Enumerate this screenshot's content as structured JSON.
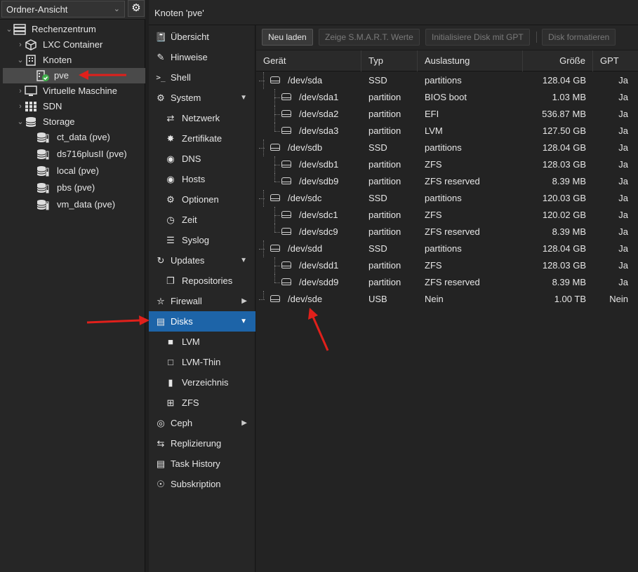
{
  "tree": {
    "view_select": "Ordner-Ansicht",
    "items": [
      {
        "label": "Rechenzentrum"
      },
      {
        "label": "LXC Container"
      },
      {
        "label": "Knoten"
      },
      {
        "label": "pve"
      },
      {
        "label": "Virtuelle Maschine"
      },
      {
        "label": "SDN"
      },
      {
        "label": "Storage"
      },
      {
        "label": "ct_data (pve)"
      },
      {
        "label": "ds716plusII (pve)"
      },
      {
        "label": "local (pve)"
      },
      {
        "label": "pbs (pve)"
      },
      {
        "label": "vm_data (pve)"
      }
    ]
  },
  "header": {
    "title": "Knoten 'pve'"
  },
  "nav": {
    "items": [
      {
        "label": "Übersicht"
      },
      {
        "label": "Hinweise"
      },
      {
        "label": "Shell"
      },
      {
        "label": "System"
      },
      {
        "label": "Netzwerk"
      },
      {
        "label": "Zertifikate"
      },
      {
        "label": "DNS"
      },
      {
        "label": "Hosts"
      },
      {
        "label": "Optionen"
      },
      {
        "label": "Zeit"
      },
      {
        "label": "Syslog"
      },
      {
        "label": "Updates"
      },
      {
        "label": "Repositories"
      },
      {
        "label": "Firewall"
      },
      {
        "label": "Disks"
      },
      {
        "label": "LVM"
      },
      {
        "label": "LVM-Thin"
      },
      {
        "label": "Verzeichnis"
      },
      {
        "label": "ZFS"
      },
      {
        "label": "Ceph"
      },
      {
        "label": "Replizierung"
      },
      {
        "label": "Task History"
      },
      {
        "label": "Subskription"
      }
    ]
  },
  "toolbar": {
    "reload": "Neu laden",
    "smart": "Zeige S.M.A.R.T. Werte",
    "init_gpt": "Initialisiere Disk mit GPT",
    "format": "Disk formatieren"
  },
  "grid": {
    "columns": [
      "Gerät",
      "Typ",
      "Auslastung",
      "Größe",
      "GPT"
    ],
    "rows": [
      {
        "device": "/dev/sda",
        "type": "SSD",
        "usage": "partitions",
        "size": "128.04 GB",
        "gpt": "Ja"
      },
      {
        "device": "/dev/sda1",
        "type": "partition",
        "usage": "BIOS boot",
        "size": "1.03 MB",
        "gpt": "Ja"
      },
      {
        "device": "/dev/sda2",
        "type": "partition",
        "usage": "EFI",
        "size": "536.87 MB",
        "gpt": "Ja"
      },
      {
        "device": "/dev/sda3",
        "type": "partition",
        "usage": "LVM",
        "size": "127.50 GB",
        "gpt": "Ja"
      },
      {
        "device": "/dev/sdb",
        "type": "SSD",
        "usage": "partitions",
        "size": "128.04 GB",
        "gpt": "Ja"
      },
      {
        "device": "/dev/sdb1",
        "type": "partition",
        "usage": "ZFS",
        "size": "128.03 GB",
        "gpt": "Ja"
      },
      {
        "device": "/dev/sdb9",
        "type": "partition",
        "usage": "ZFS reserved",
        "size": "8.39 MB",
        "gpt": "Ja"
      },
      {
        "device": "/dev/sdc",
        "type": "SSD",
        "usage": "partitions",
        "size": "120.03 GB",
        "gpt": "Ja"
      },
      {
        "device": "/dev/sdc1",
        "type": "partition",
        "usage": "ZFS",
        "size": "120.02 GB",
        "gpt": "Ja"
      },
      {
        "device": "/dev/sdc9",
        "type": "partition",
        "usage": "ZFS reserved",
        "size": "8.39 MB",
        "gpt": "Ja"
      },
      {
        "device": "/dev/sdd",
        "type": "SSD",
        "usage": "partitions",
        "size": "128.04 GB",
        "gpt": "Ja"
      },
      {
        "device": "/dev/sdd1",
        "type": "partition",
        "usage": "ZFS",
        "size": "128.03 GB",
        "gpt": "Ja"
      },
      {
        "device": "/dev/sdd9",
        "type": "partition",
        "usage": "ZFS reserved",
        "size": "8.39 MB",
        "gpt": "Ja"
      },
      {
        "device": "/dev/sde",
        "type": "USB",
        "usage": "Nein",
        "size": "1.00 TB",
        "gpt": "Nein"
      }
    ]
  },
  "colors": {
    "accent": "#1d64a8",
    "annotation": "#e0201b",
    "status_ok": "#3fae49"
  }
}
